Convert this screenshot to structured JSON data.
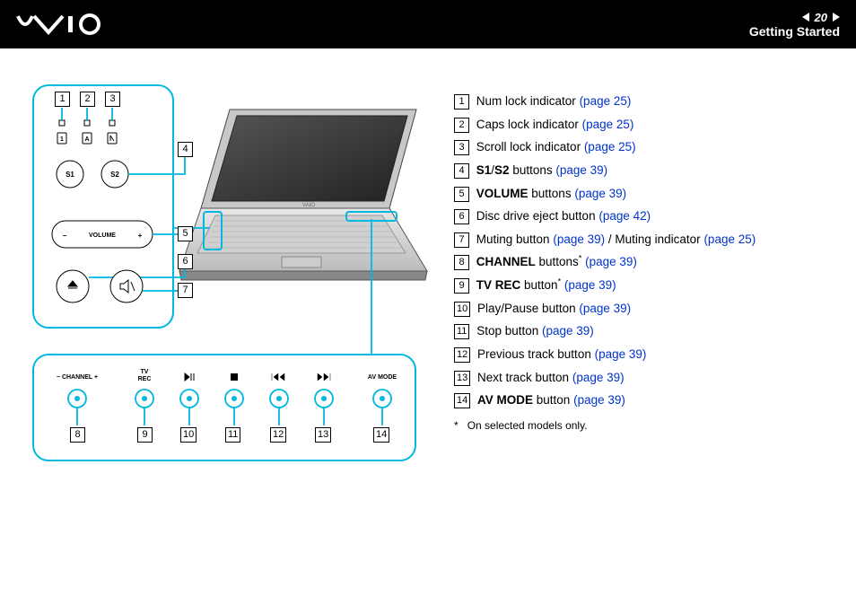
{
  "header": {
    "page_number": "20",
    "section": "Getting Started"
  },
  "legend": [
    {
      "num": "1",
      "text_before": "Num lock indicator ",
      "link": "(page 25)"
    },
    {
      "num": "2",
      "text_before": "Caps lock indicator ",
      "link": "(page 25)"
    },
    {
      "num": "3",
      "text_before": "Scroll lock indicator ",
      "link": "(page 25)"
    },
    {
      "num": "4",
      "bold1": "S1",
      "sep": "/",
      "bold2": "S2",
      "text_after": " buttons ",
      "link": "(page 39)"
    },
    {
      "num": "5",
      "bold1": "VOLUME",
      "text_after": " buttons ",
      "link": "(page 39)"
    },
    {
      "num": "6",
      "text_before": "Disc drive eject button ",
      "link": "(page 42)"
    },
    {
      "num": "7",
      "text_before": "Muting button ",
      "link": "(page 39)",
      "text_mid": " / Muting indicator ",
      "link2": "(page 25)"
    },
    {
      "num": "8",
      "bold1": "CHANNEL",
      "text_after": " buttons",
      "asterisk": "*",
      "space": " ",
      "link": "(page 39)"
    },
    {
      "num": "9",
      "bold1": "TV REC",
      "text_after": " button",
      "asterisk": "*",
      "space": " ",
      "link": "(page 39)"
    },
    {
      "num": "10",
      "text_before": "Play/Pause button ",
      "link": "(page 39)"
    },
    {
      "num": "11",
      "text_before": "Stop button ",
      "link": "(page 39)"
    },
    {
      "num": "12",
      "text_before": "Previous track button ",
      "link": "(page 39)"
    },
    {
      "num": "13",
      "text_before": "Next track button ",
      "link": "(page 39)"
    },
    {
      "num": "14",
      "bold1": "AV MODE",
      "text_after": " button ",
      "link": "(page 39)"
    }
  ],
  "footnote": {
    "mark": "*",
    "text": "On selected models only."
  },
  "diagram": {
    "top_callouts": [
      "1",
      "2",
      "3",
      "4",
      "5",
      "6",
      "7"
    ],
    "bottom_callouts": [
      "8",
      "9",
      "10",
      "11",
      "12",
      "13",
      "14"
    ],
    "labels": {
      "s1": "S1",
      "s2": "S2",
      "volume": "VOLUME",
      "minus": "−",
      "plus": "+",
      "channel": "CHANNEL",
      "tvrec": "TV\nREC",
      "avmode": "AV MODE"
    }
  }
}
